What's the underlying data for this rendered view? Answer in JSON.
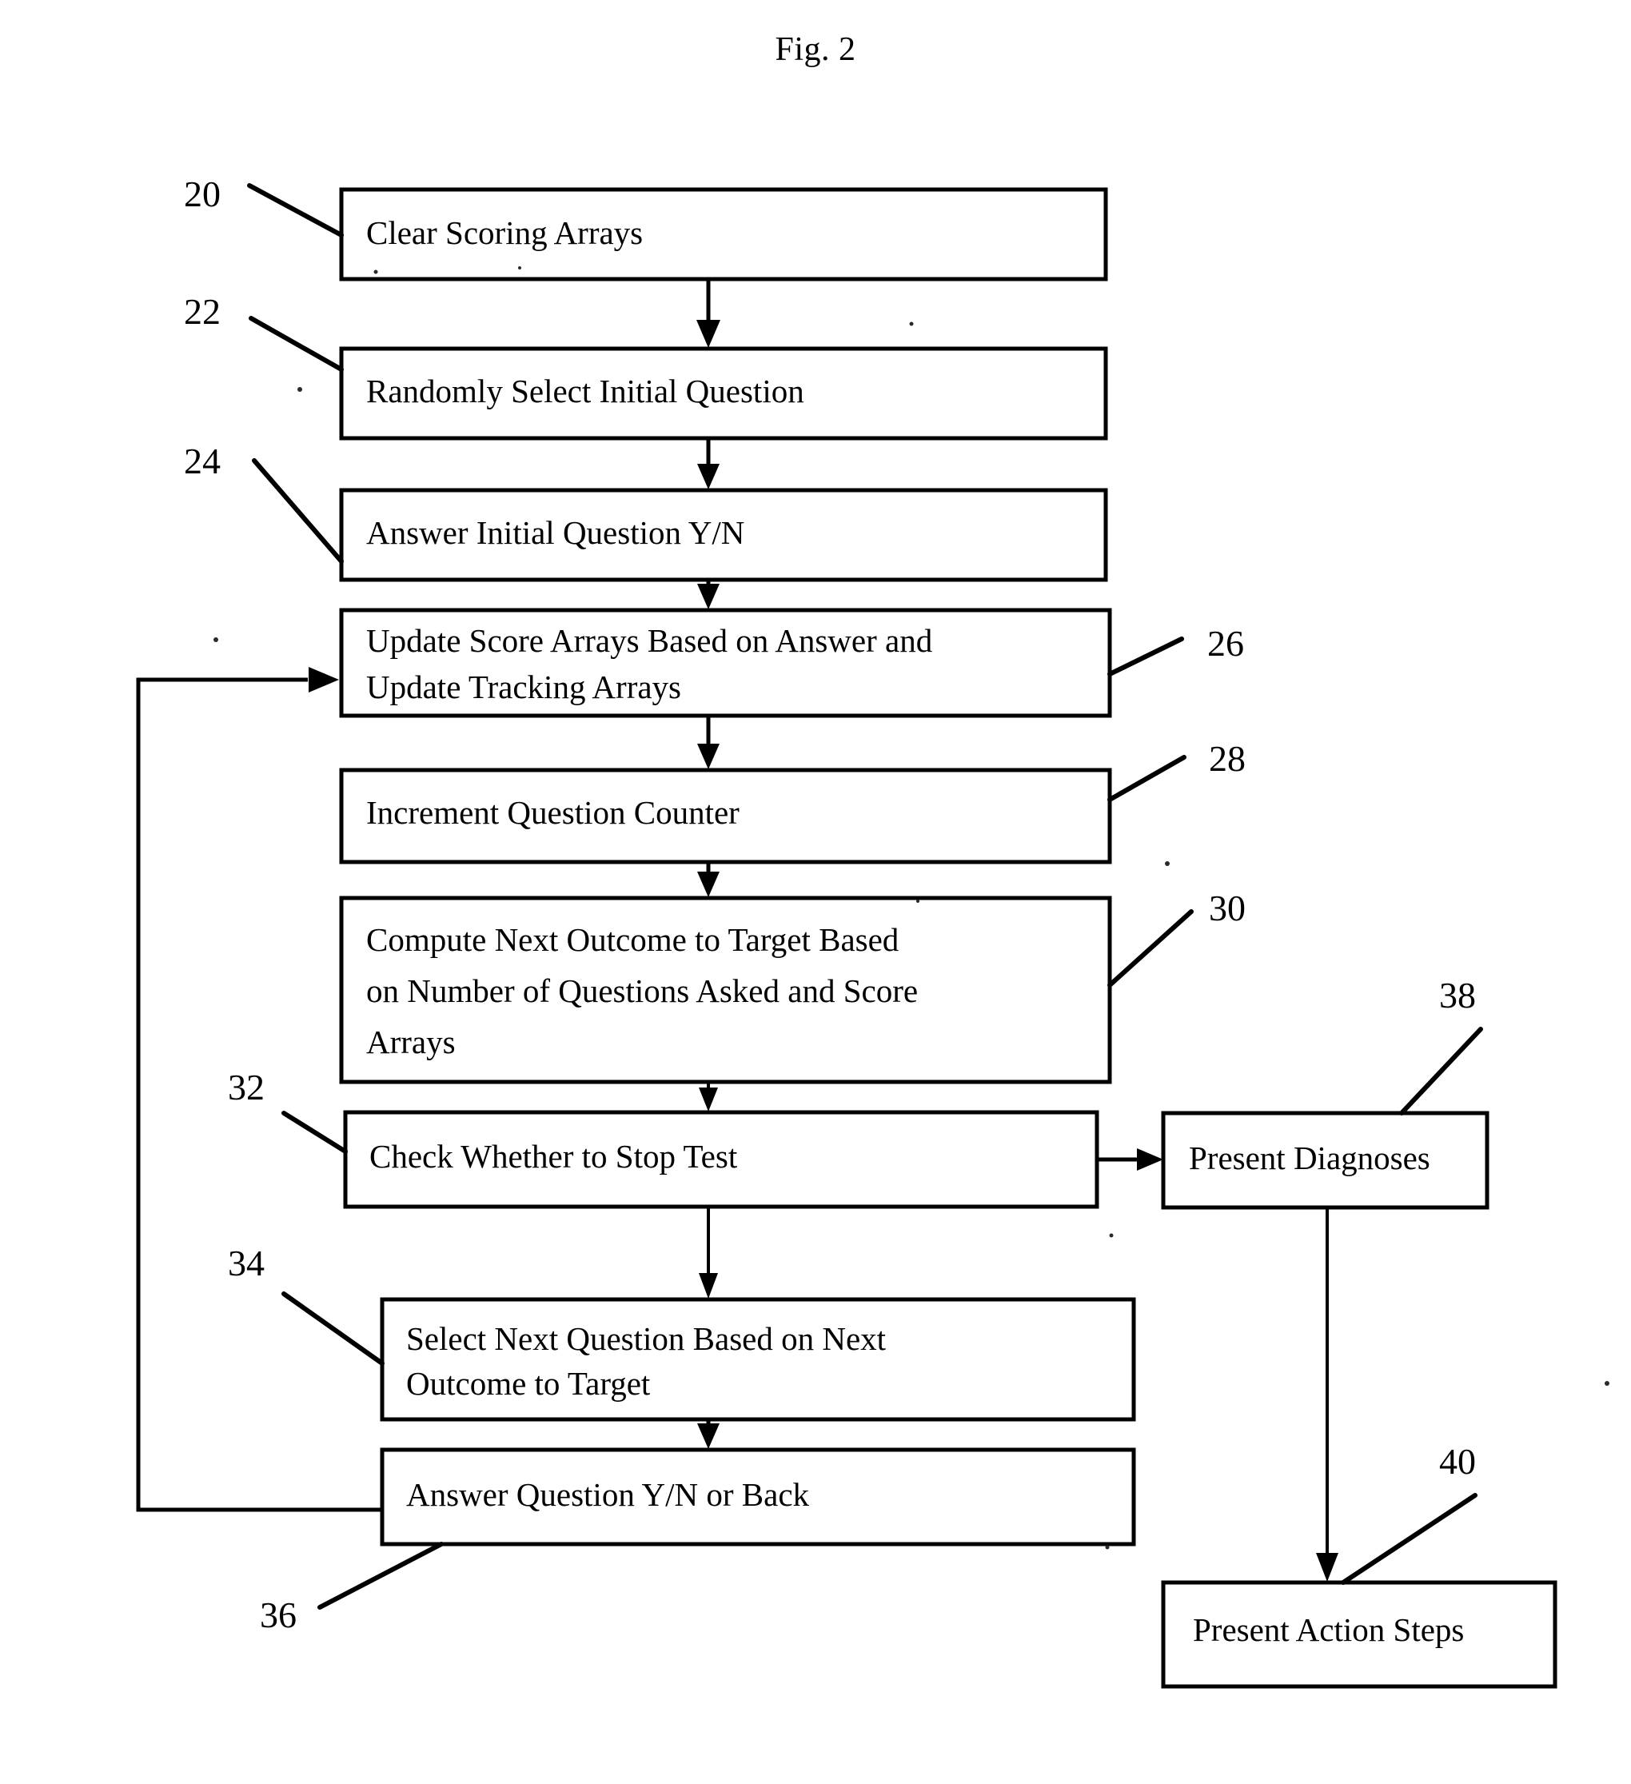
{
  "figure": {
    "title": "Fig. 2",
    "type": "patent-flowchart"
  },
  "nodes": [
    {
      "id": "n20",
      "ref": "20",
      "label_lines": [
        "Clear Scoring Arrays"
      ],
      "text": "Clear Scoring Arrays"
    },
    {
      "id": "n22",
      "ref": "22",
      "label_lines": [
        "Randomly Select Initial Question"
      ],
      "text": "Randomly Select Initial Question"
    },
    {
      "id": "n24",
      "ref": "24",
      "label_lines": [
        "Answer Initial Question Y/N"
      ],
      "text": "Answer Initial Question Y/N"
    },
    {
      "id": "n26",
      "ref": "26",
      "label_lines": [
        "Update Score Arrays Based on Answer and",
        "Update Tracking Arrays"
      ],
      "text": "Update Score Arrays Based on Answer and Update Tracking Arrays"
    },
    {
      "id": "n28",
      "ref": "28",
      "label_lines": [
        "Increment Question Counter"
      ],
      "text": "Increment Question Counter"
    },
    {
      "id": "n30",
      "ref": "30",
      "label_lines": [
        "Compute Next Outcome to Target Based",
        "on Number of Questions Asked and Score",
        "Arrays"
      ],
      "text": "Compute Next Outcome to Target Based on Number of Questions Asked and Score Arrays"
    },
    {
      "id": "n32",
      "ref": "32",
      "label_lines": [
        "Check Whether to Stop Test"
      ],
      "text": "Check Whether to Stop Test"
    },
    {
      "id": "n34",
      "ref": "34",
      "label_lines": [
        "Select Next Question Based on Next",
        "Outcome to Target"
      ],
      "text": "Select Next Question Based on Next Outcome to Target"
    },
    {
      "id": "n36",
      "ref": "36",
      "label_lines": [
        "Answer Question Y/N or Back"
      ],
      "text": "Answer Question Y/N or Back"
    },
    {
      "id": "n38",
      "ref": "38",
      "label_lines": [
        "Present Diagnoses"
      ],
      "text": "Present Diagnoses"
    },
    {
      "id": "n40",
      "ref": "40",
      "label_lines": [
        "Present Action Steps"
      ],
      "text": "Present Action Steps"
    }
  ],
  "reference_numerals": [
    "20",
    "22",
    "24",
    "26",
    "28",
    "30",
    "32",
    "34",
    "36",
    "38",
    "40"
  ],
  "colors": {
    "ink": "#000000",
    "paper": "#ffffff"
  }
}
